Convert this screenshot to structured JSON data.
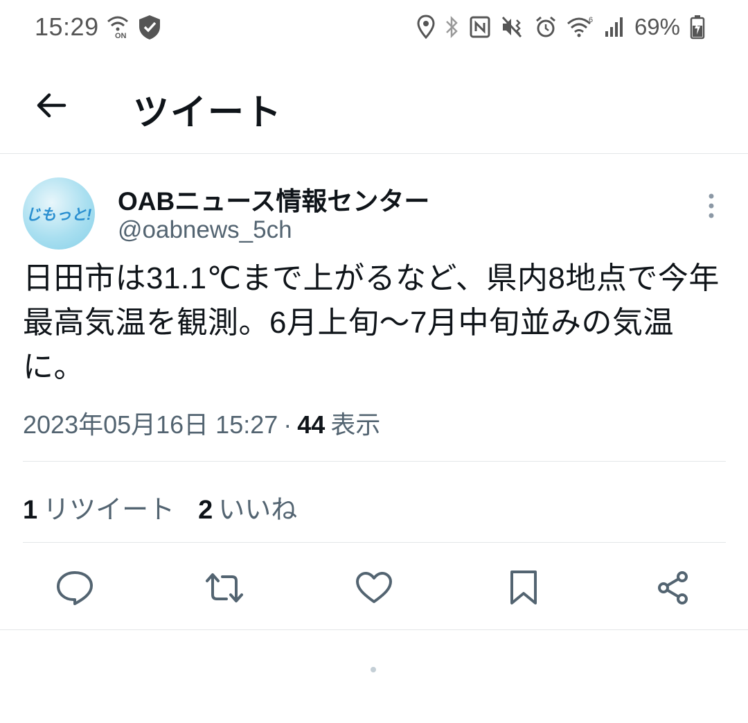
{
  "status_bar": {
    "time": "15:29",
    "battery": "69%",
    "left_icons": [
      "wifi-calling-on-icon",
      "shield-check-icon"
    ],
    "right_icons": [
      "location-icon",
      "bluetooth-icon",
      "nfc-icon",
      "vibrate-icon",
      "alarm-icon",
      "wifi-icon",
      "signal-icon",
      "battery-charging-icon"
    ]
  },
  "header": {
    "title": "ツイート",
    "back_icon": "arrow-left-icon"
  },
  "tweet": {
    "avatar_text": "じもっと!",
    "author_name": "OABニュース情報センター",
    "author_handle": "@oabnews_5ch",
    "text": "日田市は31.1℃まで上がるなど、県内8地点で今年最高気温を観測。6月上旬～7月中旬並みの気温に。",
    "timestamp": "2023年05月16日 15:27",
    "separator": "·",
    "views_count": "44",
    "views_label": "表示"
  },
  "stats": {
    "retweets_count": "1",
    "retweets_label": "リツイート",
    "likes_count": "2",
    "likes_label": "いいね"
  },
  "actions": [
    "reply-icon",
    "retweet-icon",
    "like-icon",
    "bookmark-icon",
    "share-icon"
  ],
  "colors": {
    "text_primary": "#0f1419",
    "text_secondary": "#536471",
    "divider": "#e3e6e8",
    "icon": "#536471"
  }
}
